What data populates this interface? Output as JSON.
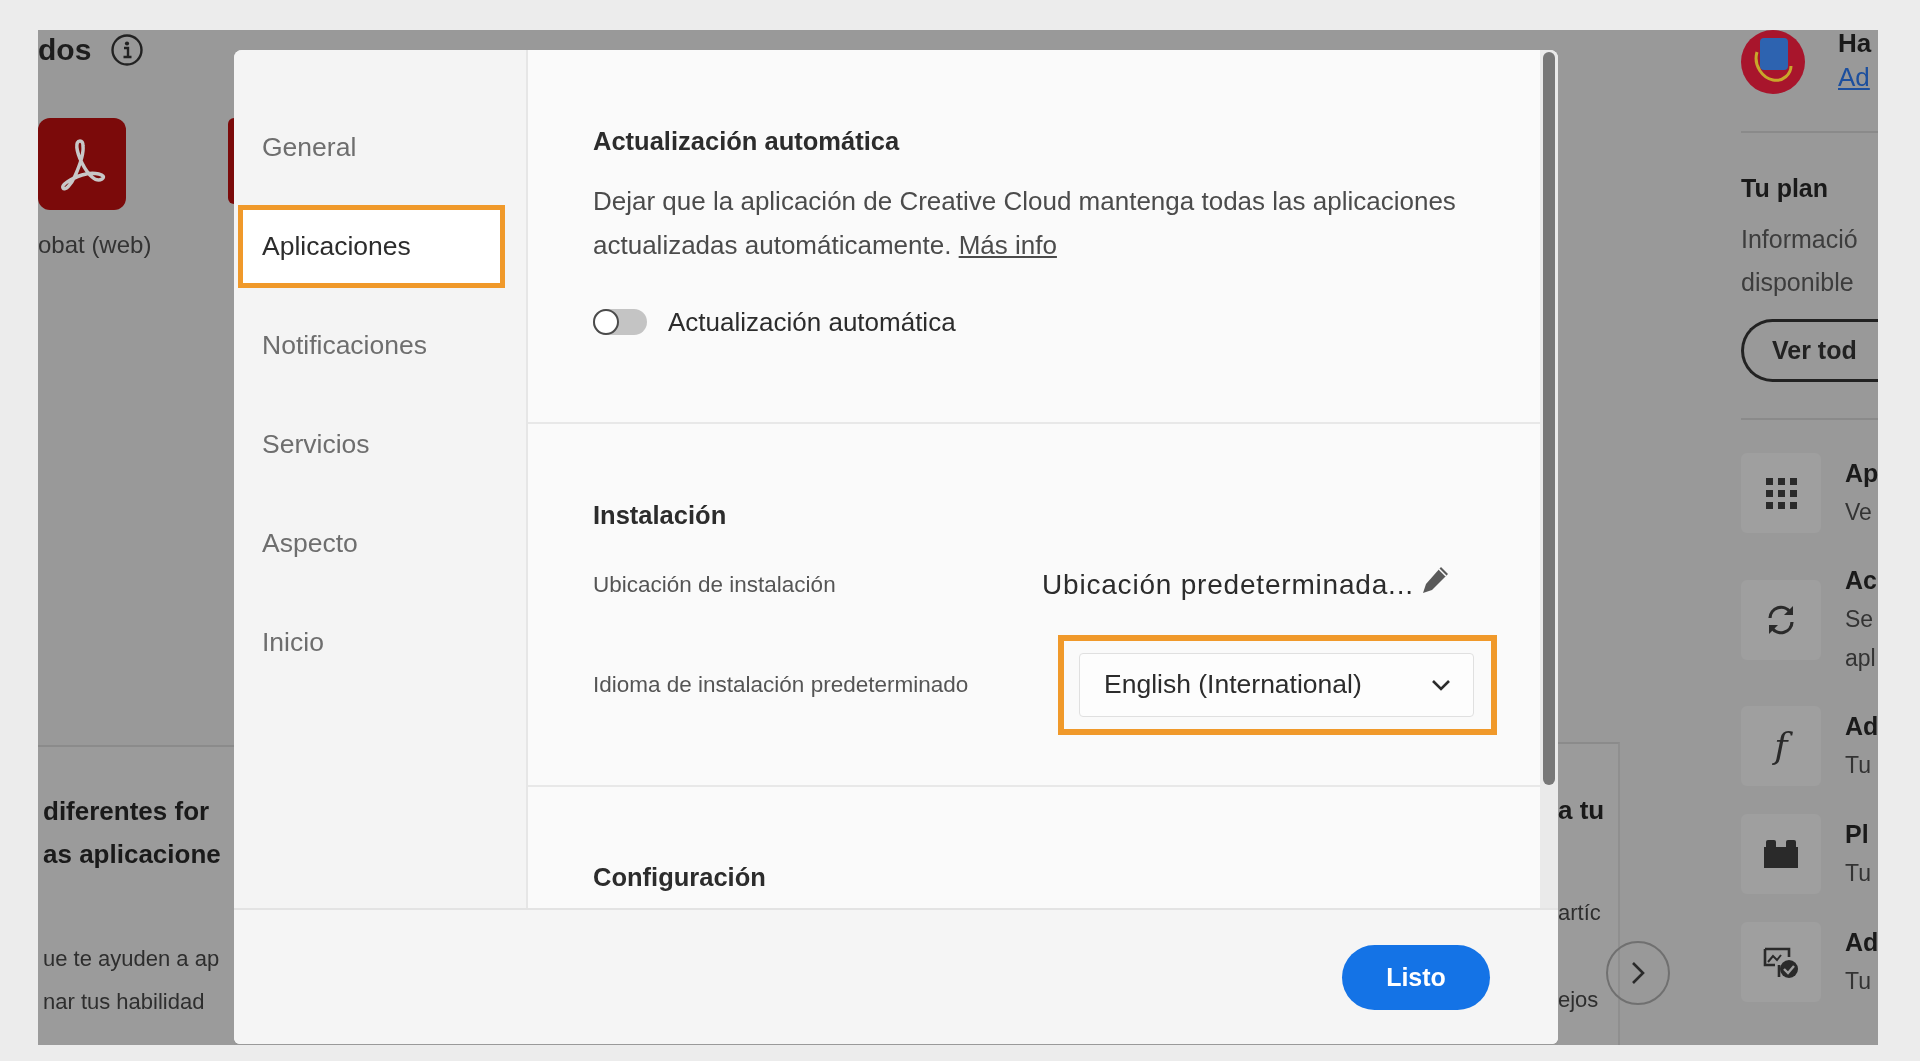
{
  "background": {
    "header": {
      "title": "dos"
    },
    "apps": [
      {
        "label": "obat (web)"
      }
    ],
    "cards": [
      {
        "heading": [
          "diferentes for",
          "as aplicacione"
        ],
        "body": [
          "ue te ayuden a ap",
          "nar tus habilidad"
        ]
      },
      {
        "heading": [
          "a tu"
        ],
        "body": [
          "artíc",
          "ejos"
        ]
      }
    ],
    "sidebar": {
      "user": {
        "name": "Ha",
        "link": "Ad"
      },
      "plan": {
        "title": "Tu plan",
        "text": [
          "Informació",
          "disponible"
        ],
        "button": "Ver tod"
      },
      "items": [
        {
          "kind": "grid",
          "title": "Ap",
          "subtitle": [
            "Ve"
          ]
        },
        {
          "kind": "sync",
          "title": "Ac",
          "subtitle": [
            "Se",
            "apl"
          ]
        },
        {
          "kind": "glyph",
          "glyph": "f",
          "title": "Ad",
          "subtitle": [
            "Tu"
          ]
        },
        {
          "kind": "block",
          "title": "Pl",
          "subtitle": [
            "Tu"
          ]
        },
        {
          "kind": "image-check",
          "title": "Ad",
          "subtitle": [
            "Tu"
          ]
        }
      ]
    }
  },
  "dialog": {
    "nav": [
      {
        "label": "General",
        "selected": false,
        "highlighted": false
      },
      {
        "label": "Aplicaciones",
        "selected": true,
        "highlighted": true
      },
      {
        "label": "Notificaciones",
        "selected": false,
        "highlighted": false
      },
      {
        "label": "Servicios",
        "selected": false,
        "highlighted": false
      },
      {
        "label": "Aspecto",
        "selected": false,
        "highlighted": false
      },
      {
        "label": "Inicio",
        "selected": false,
        "highlighted": false
      }
    ],
    "sections": [
      {
        "kind": "auto-update",
        "title": "Actualización automática",
        "description": "Dejar que la aplicación de Creative Cloud mantenga todas las aplicaciones actualizadas automáticamente.",
        "link": "Más info",
        "toggle": {
          "label": "Actualización automática",
          "on": false
        }
      },
      {
        "kind": "installation",
        "title": "Instalación",
        "rows": [
          {
            "kind": "location",
            "label": "Ubicación de instalación",
            "value": "Ubicación predeterminada..."
          },
          {
            "kind": "dropdown",
            "label": "Idioma de instalación predeterminado",
            "value": "English (International)",
            "highlighted": true
          }
        ]
      },
      {
        "kind": "heading",
        "title": "Configuración"
      }
    ],
    "done_button": "Listo"
  }
}
